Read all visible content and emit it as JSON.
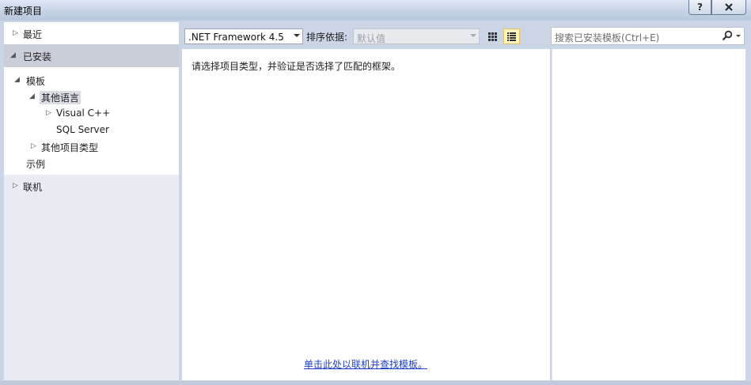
{
  "window": {
    "title": "新建项目",
    "help_label": "?",
    "close_label": "x"
  },
  "left_panel": {
    "recent": "最近",
    "installed": "已安装",
    "templates": "模板",
    "other_languages": "其他语言",
    "visual_cpp": "Visual C++",
    "sql_server": "SQL Server",
    "other_project_types": "其他项目类型",
    "samples": "示例",
    "online": "联机"
  },
  "toolbar": {
    "framework": ".NET Framework 4.5",
    "sort_label": "排序依据:",
    "sort_value": "默认值"
  },
  "search": {
    "placeholder": "搜索已安装模板(Ctrl+E)"
  },
  "middle": {
    "message": "请选择项目类型，并验证是否选择了匹配的框架。",
    "online_link": "单击此处以联机并查找模板。"
  },
  "icons": [
    "help-icon",
    "close-icon",
    "expand-arrow-icon",
    "collapse-arrow-icon",
    "small-icons-view-icon",
    "list-view-icon",
    "search-icon",
    "dropdown-arrow-icon"
  ]
}
